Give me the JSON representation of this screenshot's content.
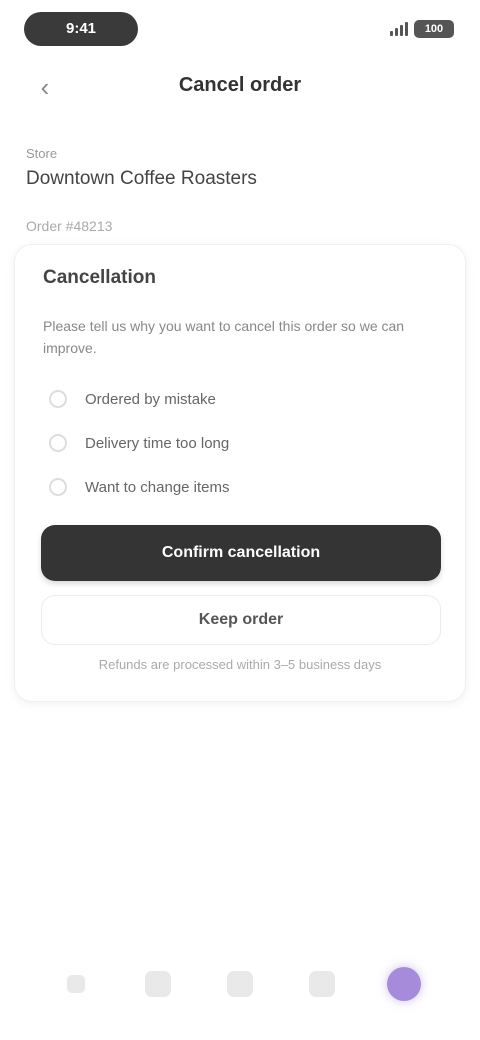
{
  "status_bar": {
    "time": "9:41",
    "battery": "100"
  },
  "header": {
    "title": "Cancel order",
    "back_icon": "chevron-left-icon"
  },
  "store": {
    "label": "Store",
    "name": "Downtown Coffee Roasters",
    "order_meta": "Order #48213"
  },
  "card": {
    "title": "Cancellation",
    "description": "Please tell us why you want to cancel this order so we can improve.",
    "options": [
      {
        "label": "Ordered by mistake"
      },
      {
        "label": "Delivery time too long"
      },
      {
        "label": "Want to change items"
      }
    ],
    "primary_button": "Confirm cancellation",
    "secondary_button": "Keep order",
    "footnote": "Refunds are processed within 3–5 business days"
  },
  "bottom_nav": {
    "items": [
      {
        "label": "",
        "icon": "home-icon",
        "active": false
      },
      {
        "label": "",
        "icon": "search-icon",
        "active": false
      },
      {
        "label": "",
        "icon": "orders-icon",
        "active": false
      },
      {
        "label": "",
        "icon": "cart-icon",
        "active": false
      },
      {
        "label": "",
        "icon": "profile-icon",
        "active": true
      }
    ],
    "accent_color": "#a78bdb"
  },
  "colors": {
    "primary_button": "#343434",
    "status_pill": "#3a3a3a"
  }
}
